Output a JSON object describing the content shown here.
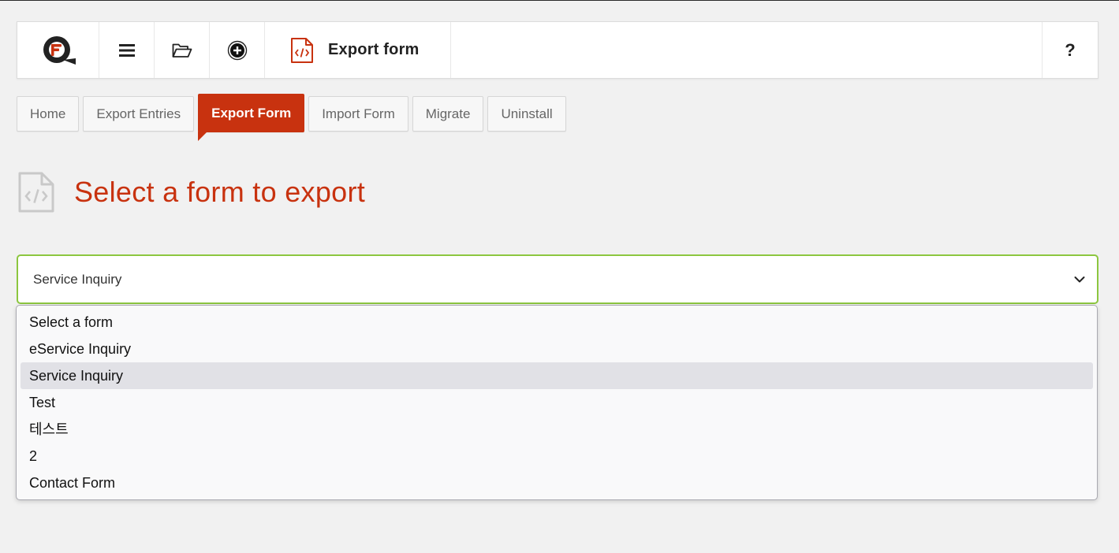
{
  "header": {
    "logo_icon": "formlift-logo-icon",
    "menu_icon": "hamburger-menu-icon",
    "folder_icon": "open-folder-icon",
    "add_icon": "plus-circle-icon",
    "title_icon": "code-file-icon",
    "title": "Export form",
    "help_label": "?"
  },
  "tabs": [
    {
      "label": "Home",
      "active": false
    },
    {
      "label": "Export Entries",
      "active": false
    },
    {
      "label": "Export Form",
      "active": true
    },
    {
      "label": "Import Form",
      "active": false
    },
    {
      "label": "Migrate",
      "active": false
    },
    {
      "label": "Uninstall",
      "active": false
    }
  ],
  "main": {
    "heading_icon": "code-file-icon",
    "heading": "Select a form to export",
    "select": {
      "value": "Service Inquiry",
      "options": [
        "Select a form",
        "eService Inquiry",
        "Service Inquiry",
        "Test",
        "테스트",
        "2",
        "Contact Form"
      ],
      "selected_index": 2
    }
  },
  "colors": {
    "accent": "#c8320f",
    "focus_border": "#8cc63f",
    "background": "#f1f1f1"
  }
}
